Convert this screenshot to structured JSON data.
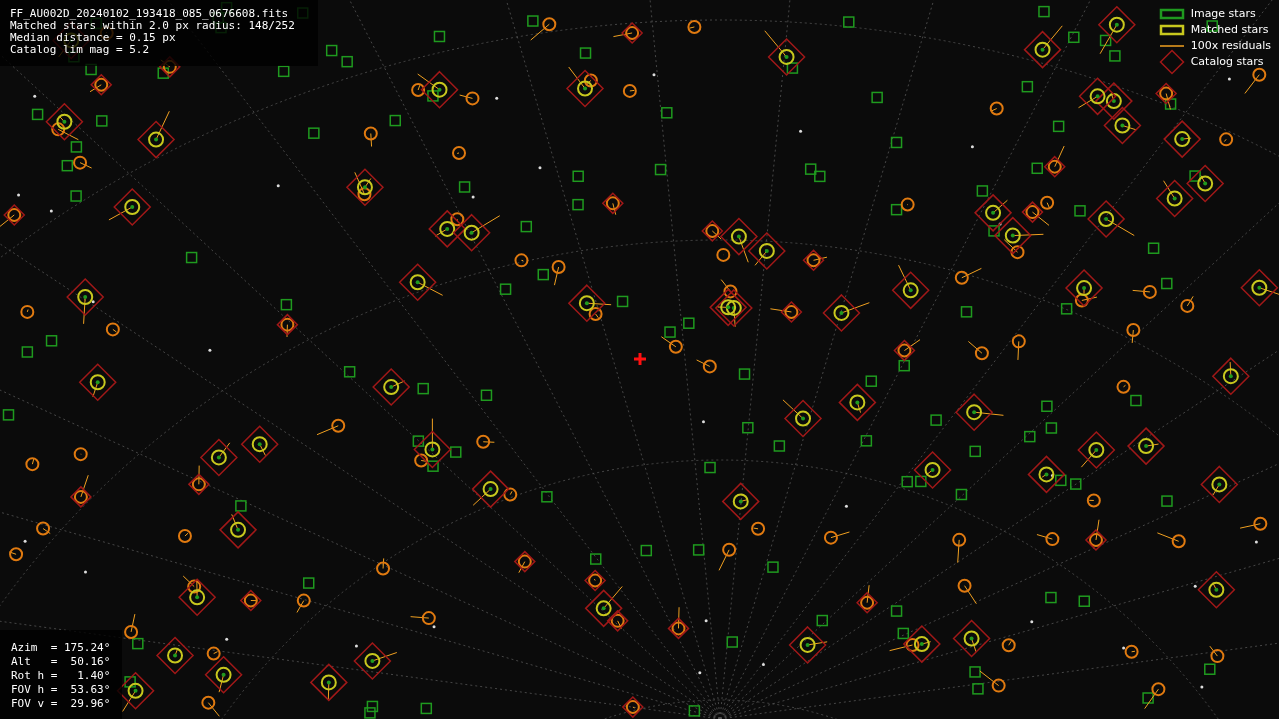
{
  "header_lines": [
    "FF_AU002D_20240102_193418_085_0676608.fits",
    "Matched stars within 2.0 px radius: 148/252",
    "Median distance = 0.15 px",
    "Catalog lim mag = 5.2"
  ],
  "legend": [
    {
      "kind": "image",
      "label": "Image stars"
    },
    {
      "kind": "matched",
      "label": "Matched stars"
    },
    {
      "kind": "residual",
      "label": "100x residuals"
    },
    {
      "kind": "catalog",
      "label": "Catalog stars"
    }
  ],
  "pointing_lines": [
    "Azim  = 175.24°",
    "Alt   =  50.16°",
    "Rot h =   1.40°",
    "FOV h =  53.63°",
    "FOV v =  29.96°"
  ]
}
